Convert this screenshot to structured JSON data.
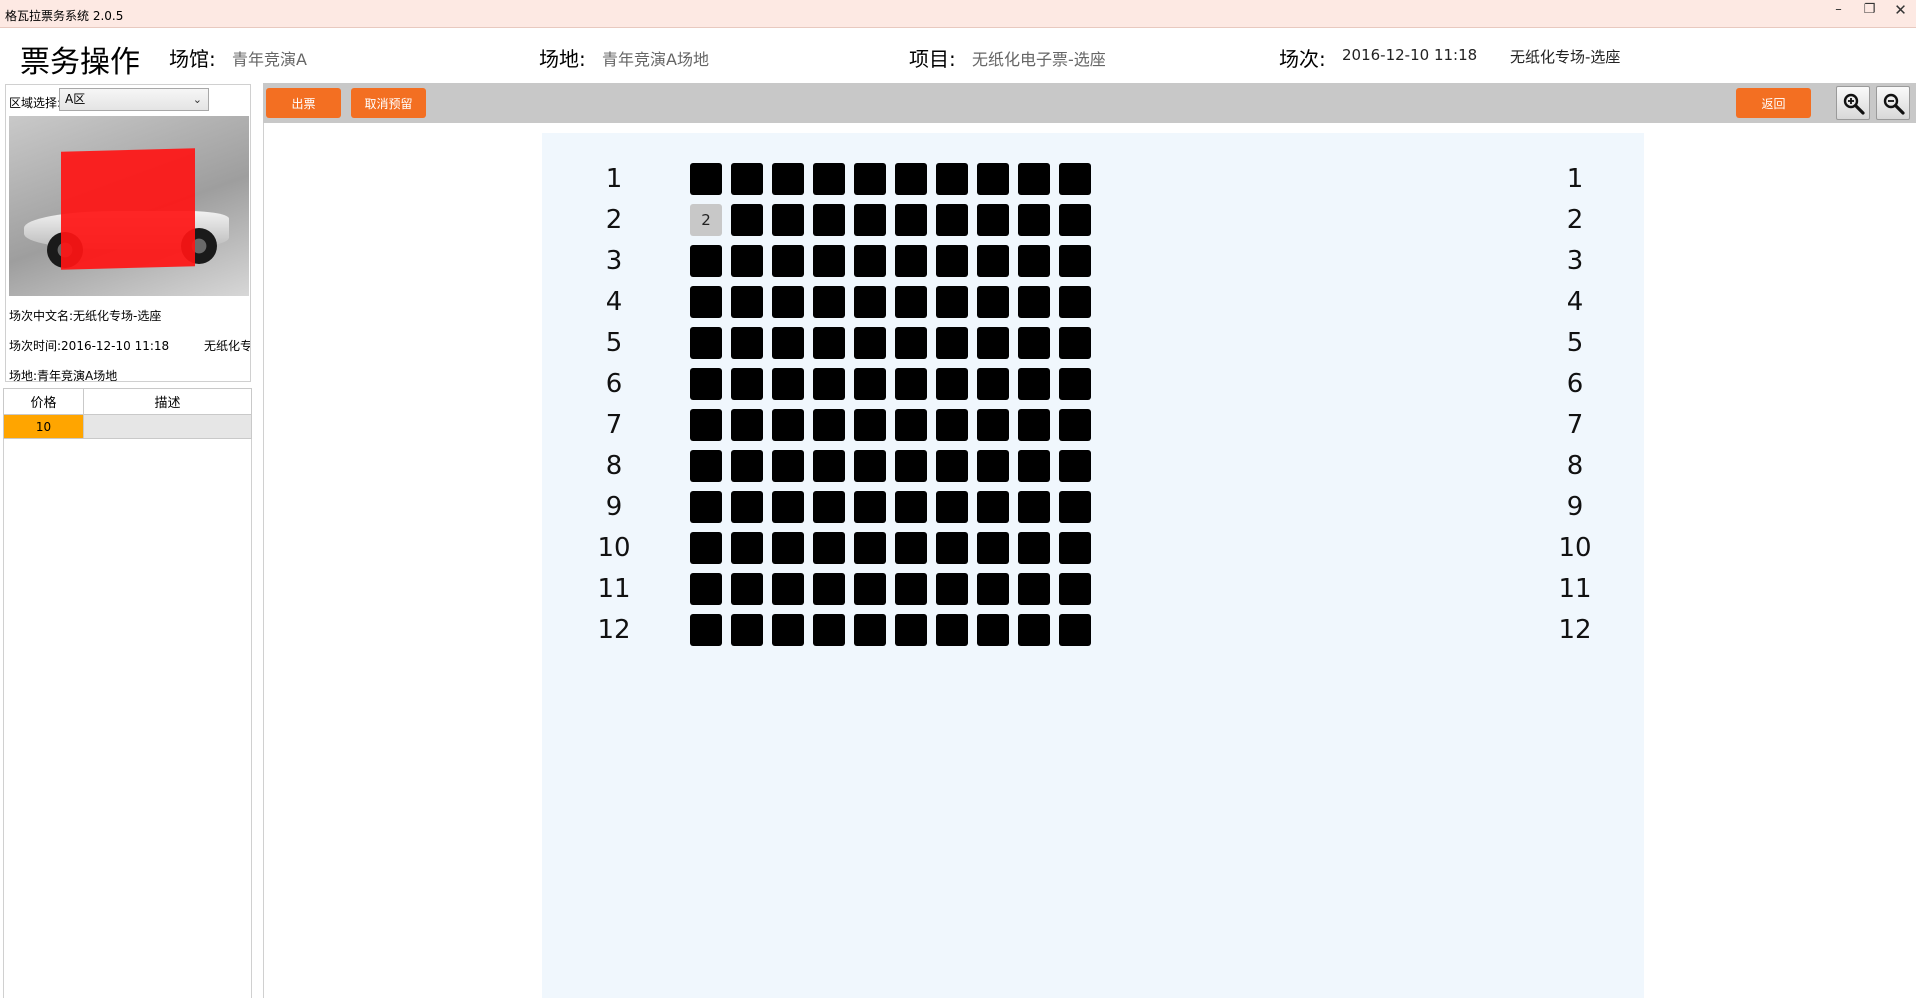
{
  "window": {
    "title": "格瓦拉票务系统 2.0.5",
    "controls": [
      "–",
      "❐",
      "✕"
    ]
  },
  "header": {
    "page_title": "票务操作",
    "venue_label": "场馆:",
    "venue_value": "青年竞演A",
    "site_label": "场地:",
    "site_value": "青年竞演A场地",
    "project_label": "项目:",
    "project_value": "无纸化电子票-选座",
    "session_label": "场次:",
    "session_time": "2016-12-10 11:18",
    "session_name": "无纸化专场-选座"
  },
  "sidebar": {
    "area_label": "区域选择:",
    "area_selected": "A区",
    "show_cn_name": "场次中文名:无纸化专场-选座",
    "show_time": "场次时间:2016-12-10 11:18",
    "show_time_extra": "无纸化专",
    "show_site": "场地:青年竞演A场地",
    "price_table": {
      "headers": [
        "价格",
        "描述"
      ],
      "rows": [
        {
          "price": "10",
          "desc": ""
        }
      ]
    }
  },
  "toolbar": {
    "issue_ticket": "出票",
    "cancel_reservation": "取消预留",
    "back": "返回",
    "zoom_in_icon": "zoom-in-icon",
    "zoom_out_icon": "zoom-out-icon"
  },
  "seatmap": {
    "rows": [
      "1",
      "2",
      "3",
      "4",
      "5",
      "6",
      "7",
      "8",
      "9",
      "10",
      "11",
      "12"
    ],
    "seats_per_row": 10,
    "selected_seats": [
      {
        "row": "2",
        "seat": 1,
        "label": "2"
      }
    ],
    "colors": {
      "available": "#000000",
      "selected": "#c8c8c8",
      "background": "#f0f7fd",
      "accent": "#f36f22",
      "price_highlight": "#ffa500"
    }
  }
}
